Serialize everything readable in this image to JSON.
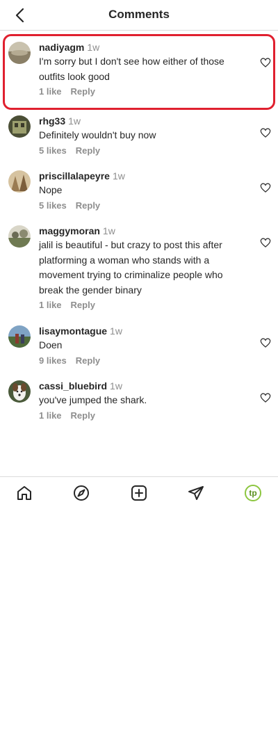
{
  "header": {
    "title": "Comments",
    "back_icon": "chevron-left-icon"
  },
  "comments": [
    {
      "username": "nadiyagm",
      "time": "1w",
      "text": "I'm sorry but I don't see how either of those outfits look good",
      "likes": "1 like",
      "reply": "Reply",
      "highlighted": true
    },
    {
      "username": "rhg33",
      "time": "1w",
      "text": "Definitely wouldn't buy now",
      "likes": "5 likes",
      "reply": "Reply"
    },
    {
      "username": "priscillalapeyre",
      "time": "1w",
      "text": "Nope",
      "likes": "5 likes",
      "reply": "Reply"
    },
    {
      "username": "maggymoran",
      "time": "1w",
      "text": "jalil is beautiful - but crazy to post this after platforming a woman who stands with a movement trying to criminalize people who break the gender binary",
      "likes": "1 like",
      "reply": "Reply"
    },
    {
      "username": "lisaymontague",
      "time": "1w",
      "text": "Doen",
      "likes": "9 likes",
      "reply": "Reply"
    },
    {
      "username": "cassi_bluebird",
      "time": "1w",
      "text": "you've jumped the shark.",
      "likes": "1 like",
      "reply": "Reply"
    }
  ],
  "tabbar": {
    "items": [
      "home-icon",
      "explore-icon",
      "new-post-icon",
      "direct-message-icon",
      "profile-avatar"
    ],
    "profile_initials": "tp"
  },
  "colors": {
    "highlight": "#e0202f",
    "muted": "#8e8e8e",
    "text": "#262626",
    "profile_ring": "#8cc63f"
  }
}
